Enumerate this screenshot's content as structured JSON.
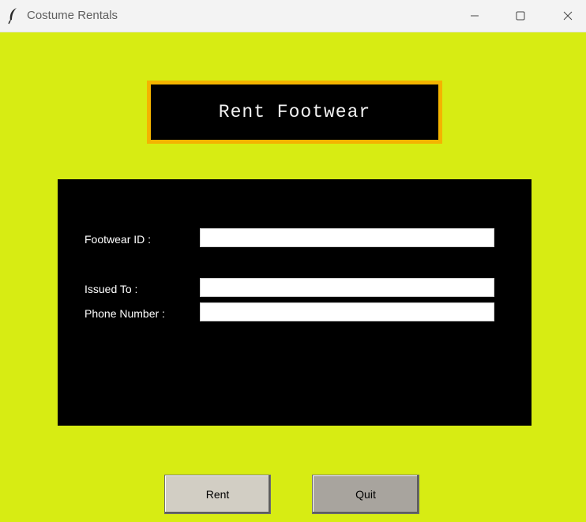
{
  "window": {
    "title": "Costume Rentals",
    "app_icon": "feather-icon",
    "controls": [
      "minimize-icon",
      "maximize-icon",
      "close-icon"
    ]
  },
  "colors": {
    "background": "#d7ec13",
    "heading_border": "#f4b400",
    "panel": "#000000",
    "rent_button": "#d2cec4",
    "quit_button": "#a8a49e"
  },
  "heading": {
    "text": "Rent Footwear"
  },
  "form": {
    "fields": [
      {
        "label": "Footwear ID :",
        "value": "",
        "placeholder": ""
      },
      {
        "label": "Issued To :",
        "value": "",
        "placeholder": ""
      },
      {
        "label": "Phone Number :",
        "value": "",
        "placeholder": ""
      }
    ]
  },
  "buttons": {
    "rent_label": "Rent",
    "quit_label": "Quit"
  }
}
